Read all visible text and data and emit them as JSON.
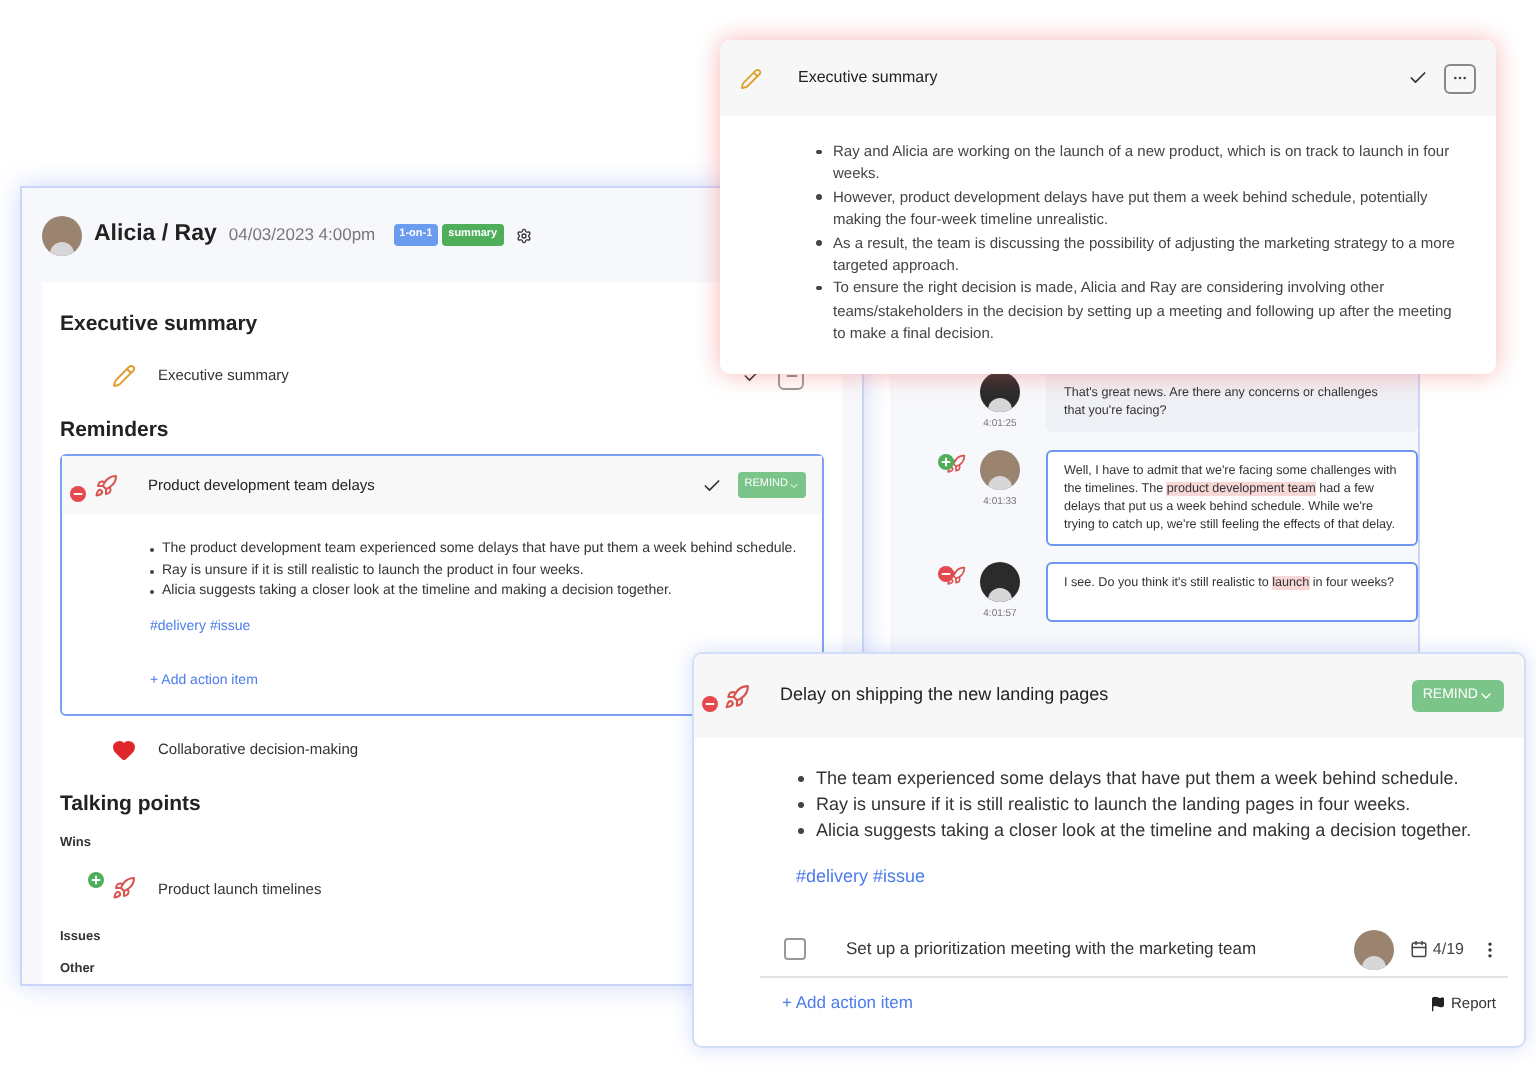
{
  "meeting": {
    "title": "Alicia / Ray",
    "datetime": "04/03/2023 4:00pm",
    "tags": [
      {
        "label": "1-on-1",
        "color": "#6c9cf0"
      },
      {
        "label": "summary",
        "color": "#4fae5a"
      }
    ],
    "sections": [
      {
        "heading": "Executive summary",
        "items": [
          {
            "kind": "summary",
            "title": "Executive summary"
          }
        ]
      },
      {
        "heading": "Reminders",
        "items": [
          {
            "kind": "goal",
            "badge": {
              "kind": "minus"
            },
            "title": "Product development team delays",
            "expanded": true,
            "button": "REMIND",
            "bullets": [
              "The product development team experienced some delays that have put them a week behind schedule.",
              "Ray is unsure if it is still realistic to launch the product in four weeks.",
              "Alicia suggests taking a closer look at the timeline and making a decision together."
            ],
            "hashtags": "#delivery #issue",
            "add_action": "+ Add action item"
          },
          {
            "kind": "value",
            "title": "Collaborative decision-making"
          }
        ]
      },
      {
        "heading": "Talking points",
        "groups": [
          {
            "label": "Wins",
            "items": [
              {
                "kind": "goal",
                "badge": {
                  "kind": "plus"
                },
                "title": "Product launch timelines"
              }
            ]
          },
          {
            "label": "Issues"
          },
          {
            "label": "Other"
          }
        ]
      }
    ]
  },
  "summary_popup": {
    "title": "Executive summary",
    "bullets": [
      "Ray and Alicia are working on the launch of a new product, which is on track to launch in four weeks.",
      "However, product development delays have put them a week behind schedule, potentially making the four-week timeline unrealistic.",
      "As a result, the team is discussing the possibility of adjusting the marketing strategy to a more targeted approach.",
      "To ensure the right decision is made, Alicia and Ray are considering involving other teams/stakeholders in the decision by setting up a meeting and following up after the meeting to make a final decision."
    ]
  },
  "transcript": {
    "messages": [
      {
        "kind": "host",
        "time": "4:01:25",
        "linked": false,
        "segments": [
          {
            "text": "That's great news. Are there any concerns or challenges that you're facing?",
            "highlight": false
          }
        ]
      },
      {
        "kind": "guest",
        "badge": {
          "kind": "plus"
        },
        "time": "4:01:33",
        "linked": true,
        "segments": [
          {
            "text": "Well, I have to admit that we're facing some challenges with the timelines. The ",
            "highlight": false
          },
          {
            "text": "product development team",
            "highlight": true
          },
          {
            "text": " had a few delays that put us a week behind schedule. While we're trying to catch up, we're still feeling the effects of that delay.",
            "highlight": false
          }
        ]
      },
      {
        "kind": "host",
        "badge": {
          "kind": "minus"
        },
        "time": "4:01:57",
        "linked": true,
        "segments": [
          {
            "text": "I see. Do you think it's still realistic to ",
            "highlight": false
          },
          {
            "text": "launch",
            "highlight": true
          },
          {
            "text": " in four weeks?",
            "highlight": false
          }
        ]
      }
    ]
  },
  "reminder_card": {
    "badge": {
      "kind": "minus"
    },
    "title": "Delay on shipping the new landing pages",
    "button": "REMIND",
    "bullets": [
      "The team experienced some delays that have put them a week behind schedule.",
      "Ray is unsure if it is still realistic to launch the landing pages in four weeks.",
      "Alicia suggests taking a closer look at the timeline and making a decision together."
    ],
    "hashtags": "#delivery #issue",
    "action_items": [
      {
        "text": "Set up a prioritization meeting with the marketing team",
        "checked": false,
        "due": "4/19"
      }
    ],
    "add_action": "+ Add action item",
    "report": "Report"
  }
}
